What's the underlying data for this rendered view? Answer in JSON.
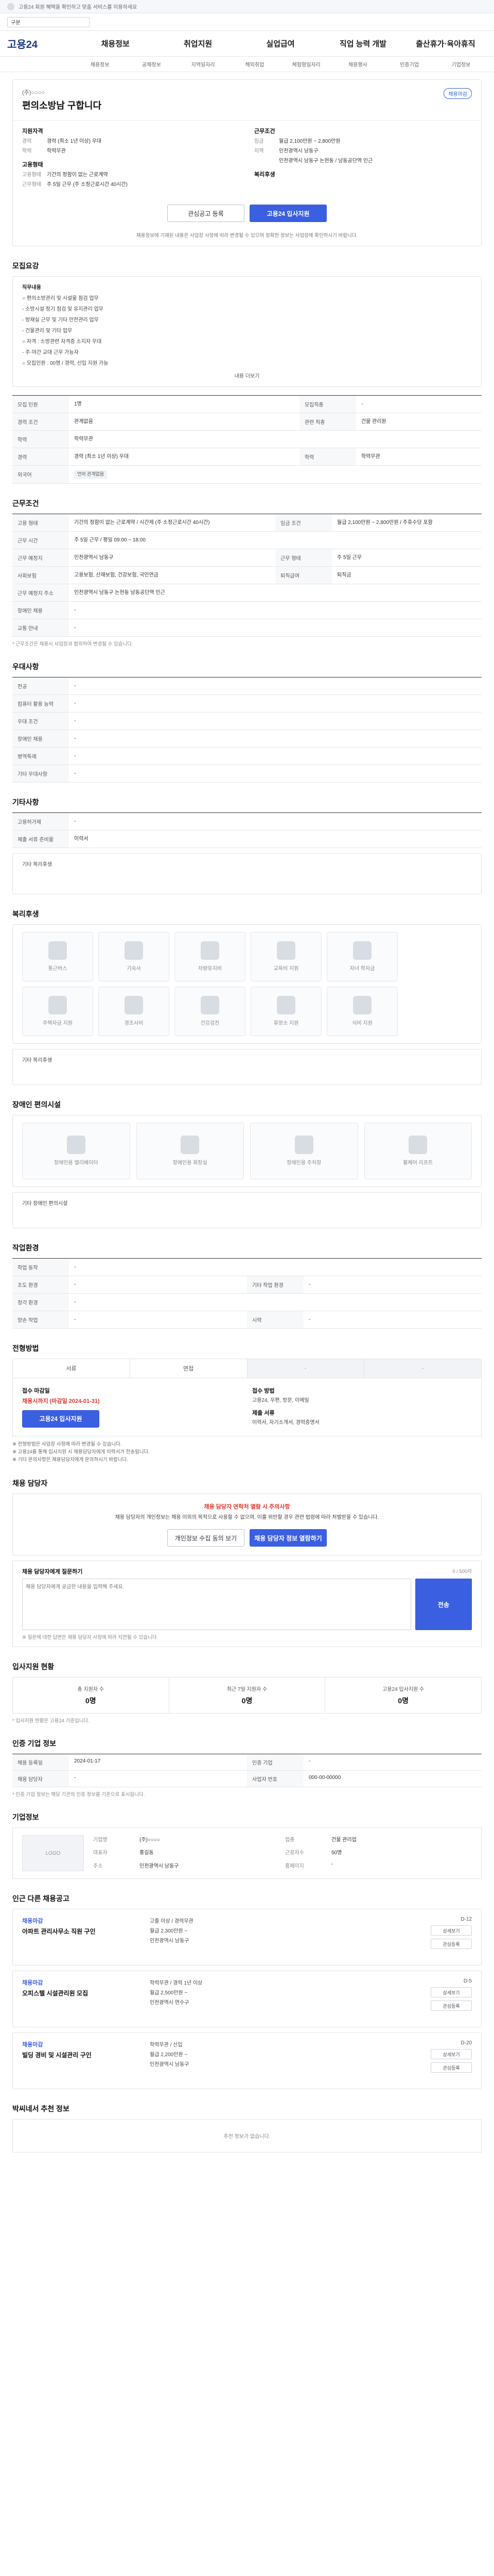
{
  "topbar": {
    "note": "고용24 회원 혜택을 확인하고 맞춤 서비스를 이용하세요",
    "search_select": "구분"
  },
  "gnb": {
    "logo": "고용24",
    "menus": [
      "채용정보",
      "취업지원",
      "실업급여",
      "직업 능력 개발",
      "출산휴가·육아휴직"
    ],
    "submenus": [
      "채용정보",
      "공채정보",
      "지역일자리",
      "해외취업",
      "체험형일자리",
      "채용행사",
      "인증기업",
      "기업정보"
    ]
  },
  "job": {
    "company": "(주)○○○○",
    "title": "편의소방남 구합니다",
    "badge": "채용마감",
    "left_title": "지원자격",
    "left_rows": [
      {
        "k": "경력",
        "v": "경력 (최소 1년 이상) 우대"
      },
      {
        "k": "학력",
        "v": "학력무관"
      }
    ],
    "left_title2": "고용형태",
    "left_rows2": [
      {
        "k": "고용형태",
        "v": "기간의 정함이 없는 근로계약"
      },
      {
        "k": "근무형태",
        "v": "주 5일 근무 (주 소정근로시간 40시간)"
      }
    ],
    "right_title": "근무조건",
    "right_rows": [
      {
        "k": "임금",
        "v": "월급 2,100만원 ~ 2,800만원"
      },
      {
        "k": "지역",
        "v": "인천광역시 남동구"
      },
      {
        "k": "",
        "v": "인천광역시 남동구 논현동 / 남동공단역 인근"
      }
    ],
    "right_title2": "복리후생",
    "apply_btn": "관심공고 등록",
    "apply_btn2": "고용24 입사지원",
    "notice": "채용정보에 기재된 내용은 사업장 사정에 따라 변경될 수 있으며 정확한 정보는 사업장에 확인하시기 바랍니다."
  },
  "sections": {
    "duty_title": "모집요강",
    "duty_items": [
      "직무내용",
      "○ 편의소방관리 및 시설물 점검 업무",
      "  - 소방시설 정기 점검 및 유지관리 업무",
      "  - 방재실 근무 및 기타 안전관리 업무",
      "  - 건물관리 및 기타 업무",
      "○ 자격 : 소방관련 자격증 소지자 우대",
      "  - 주·야간 교대 근무 가능자",
      "○ 모집인원 : 00명 / 경력, 신입 지원 가능"
    ],
    "duty_more": "내용 더보기",
    "base_rows": [
      {
        "k": "모집 인원",
        "v": "1명",
        "k2": "모집직종",
        "v2": "-"
      },
      {
        "k": "경력 조건",
        "v": "관계없음",
        "k2": "관련 직종",
        "v2": "건물 관리원"
      },
      {
        "k": "학력",
        "v": "학력무관",
        "k2": "",
        "v2": ""
      },
      {
        "k": "경력",
        "v": "경력 (최소 1년 이상) 우대",
        "k2": "학력",
        "v2": "학력무관"
      },
      {
        "k": "외국어",
        "v": "언어 관계없음",
        "k2": "",
        "v2": ""
      }
    ],
    "cond_title": "근무조건",
    "cond_rows": [
      {
        "k": "고용 형태",
        "v": "기간의 정함이 없는 근로계약 / 시간제 (주 소정근로시간 40시간)",
        "k2": "임금 조건",
        "v2": "월급 2,100만원 ~ 2,800만원 / 주휴수당 포함"
      },
      {
        "k": "근무 시간",
        "v": "주 5일 근무 / 평일 09:00 ~ 18:00",
        "k2": "",
        "v2": ""
      },
      {
        "k": "근무 예정지",
        "v": "인천광역시 남동구",
        "k2": "근무 형태",
        "v2": "주 5일 근무"
      },
      {
        "k": "사회보험",
        "v": "고용보험, 산재보험, 건강보험, 국민연금",
        "k2": "퇴직급여",
        "v2": "퇴직금"
      },
      {
        "k": "근무 예정지 주소",
        "v": "인천광역시 남동구 논현동 남동공단역 인근",
        "k2": "",
        "v2": ""
      },
      {
        "k": "장애인 채용",
        "v": "-",
        "k2": "",
        "v2": ""
      },
      {
        "k": "교통 안내",
        "v": "-",
        "k2": "",
        "v2": ""
      }
    ],
    "cond_note": "* 근무조건은 채용시 사업장과 협의하여 변경될 수 있습니다.",
    "pref_title": "우대사항",
    "pref_rows": [
      {
        "k": "전공",
        "v": "-"
      },
      {
        "k": "컴퓨터 활용 능력",
        "v": "-"
      },
      {
        "k": "우대 조건",
        "v": "-"
      },
      {
        "k": "장애인 채용",
        "v": "-"
      },
      {
        "k": "병역특례",
        "v": "-"
      },
      {
        "k": "기타 우대사항",
        "v": "-"
      }
    ],
    "etc_title": "기타사항",
    "etc_rows": [
      {
        "k": "고용허가제",
        "v": "-"
      },
      {
        "k": "제출 서류 준비물",
        "v": "이력서"
      }
    ],
    "etc_sub": "기타 복리후생",
    "welfare_title": "복리후생",
    "welfare_items": [
      "통근버스",
      "기숙사",
      "차량유지비",
      "교육비 지원",
      "자녀 학자금",
      "주택자금 지원",
      "경조사비",
      "건강검진",
      "휴양소 지원",
      "식비 지원"
    ],
    "welfare_sub": "기타 복리후생",
    "faci_title": "장애인 편의시설",
    "faci_items": [
      "장애인용 엘리베이터",
      "장애인용 화장실",
      "장애인용 주차장",
      "휠체어 리프트"
    ],
    "faci_sub": "기타 장애인 편의시설",
    "env_title": "작업환경",
    "env_rows": [
      {
        "k": "작업 동작",
        "v": "-",
        "k2": "",
        "v2": ""
      },
      {
        "k": "조도 환경",
        "v": "-",
        "k2": "기타 작업 환경",
        "v2": "-"
      },
      {
        "k": "청각 환경",
        "v": "-",
        "k2": "",
        "v2": ""
      },
      {
        "k": "양손 작업",
        "v": "-",
        "k2": "시력",
        "v2": "-"
      }
    ],
    "apply_title": "전형방법",
    "apply_tabs": [
      "서류",
      "면접",
      "-",
      "-"
    ],
    "apply_left_t": "접수 마감일",
    "apply_left_v": "채용시까지 (마감일 2024-01-31)",
    "apply_left_btn": "고용24 입사지원",
    "apply_right_t": "접수 방법",
    "apply_right_v": "고용24, 우편, 방문, 이메일",
    "apply_right_t2": "제출 서류",
    "apply_right_v2": "이력서, 자기소개서, 경력증명서",
    "apply_notes": [
      "※ 전형방법은 사업장 사정에 따라 변경될 수 있습니다.",
      "※ 고용24를 통해 입사지원 시 채용담당자에게 이력서가 전송됩니다.",
      "※ 기타 문의사항은 채용담당자에게 문의하시기 바랍니다."
    ],
    "mgr_title": "채용 담당자",
    "mgr_warn": "채용 담당자 연락처 열람 시 주의사항",
    "mgr_desc": "채용 담당자의 개인정보는 채용 이외의 목적으로 사용할 수 없으며, 이를 위반할 경우 관련 법령에 따라 처벌받을 수 있습니다.",
    "mgr_btn1": "개인정보 수집 동의 보기",
    "mgr_btn2": "채용 담당자 정보 열람하기",
    "qa_title": "채용 담당자에게 질문하기",
    "qa_count": "0 / 500자",
    "qa_placeholder": "채용 담당자에게 궁금한 내용을 입력해 주세요.",
    "qa_send": "전송",
    "qa_notes": [
      "※ 질문에 대한 답변은 채용 담당자 사정에 따라 지연될 수 있습니다."
    ],
    "stat_title": "입사지원 현황",
    "stats": [
      {
        "t": "총 지원자 수",
        "n": "0명"
      },
      {
        "t": "최근 7일 지원자 수",
        "n": "0명"
      },
      {
        "t": "고용24 입사지원 수",
        "n": "0명"
      }
    ],
    "stat_note": "* 입사지원 현황은 고용24 기준입니다.",
    "hire_title": "인증 기업 정보",
    "hire_rows": [
      {
        "k": "채용 등록일",
        "v": "2024-01-17",
        "k2": "인증 기업",
        "v2": "-"
      },
      {
        "k": "채용 담당자",
        "v": "-",
        "k2": "사업자 번호",
        "v2": "000-00-00000"
      }
    ],
    "hire_notes": [
      "* 인증 기업 정보는 해당 기관의 인증 정보를 기준으로 표시됩니다."
    ],
    "comp_title": "기업정보",
    "comp_logo": "LOGO",
    "comp_rows": [
      {
        "k": "기업명",
        "v": "(주)○○○○",
        "k2": "업종",
        "v2": "건물 관리업"
      },
      {
        "k": "대표자",
        "v": "홍길동",
        "k2": "근로자수",
        "v2": "50명"
      },
      {
        "k": "주소",
        "v": "인천광역시 남동구",
        "k2": "홈페이지",
        "v2": "-"
      }
    ],
    "other_title": "인근 다른 채용공고",
    "other_items": [
      {
        "ttl": "채용마감",
        "t2": "아파트 관리사무소 직원 구인",
        "rows": [
          "고졸 이상 / 경력무관",
          "월급 2,300만원 ~",
          "인천광역시 남동구"
        ],
        "dl": "D-12"
      },
      {
        "ttl": "채용마감",
        "t2": "오피스텔 시설관리원 모집",
        "rows": [
          "학력무관 / 경력 1년 이상",
          "월급 2,500만원 ~",
          "인천광역시 연수구"
        ],
        "dl": "D-5"
      },
      {
        "ttl": "채용마감",
        "t2": "빌딩 경비 및 시설관리 구인",
        "rows": [
          "학력무관 / 신입",
          "월급 2,200만원 ~",
          "인천광역시 남동구"
        ],
        "dl": "D-20"
      }
    ],
    "other_btn": "상세보기",
    "other_btn2": "관심등록",
    "rec_title": "박씨네서 추천 정보",
    "rec_empty": "추천 정보가 없습니다."
  }
}
